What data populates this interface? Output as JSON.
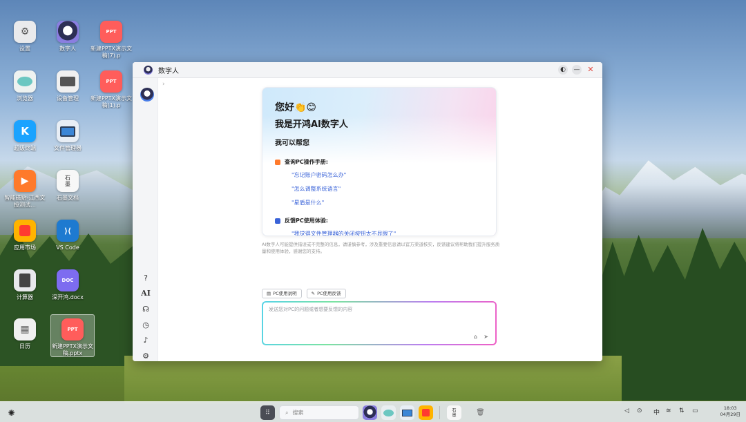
{
  "desktop": {
    "icons": [
      {
        "label": "设置",
        "glyph": "⚙",
        "color": "#e9eaec"
      },
      {
        "label": "数字人",
        "glyph": "●",
        "color": "#e3e0f4"
      },
      {
        "label": "新建PPTX演示文稿(7).p",
        "glyph": "PPT",
        "color": "#ff5d5b"
      },
      {
        "label": "浏览器",
        "glyph": "◉",
        "color": "#eef2f0"
      },
      {
        "label": "设备管理",
        "glyph": "▭",
        "color": "#f0f0f0"
      },
      {
        "label": "新建PPTX演示文稿(1).p",
        "glyph": "PPT",
        "color": "#ff5d5b"
      },
      {
        "label": "超级终端",
        "glyph": "K",
        "color": "#1aa3ff"
      },
      {
        "label": "文件管理器",
        "glyph": "▭",
        "color": "#e8eef5"
      },
      {
        "label": "智能磁贴-江西文投测试…",
        "glyph": "▶",
        "color": "#ff7a2b"
      },
      {
        "label": "石墨文档",
        "glyph": "石墨",
        "color": "#f7f7f7"
      },
      {
        "label": "应用市场",
        "glyph": "▣",
        "color": "#ffb400"
      },
      {
        "label": "VS Code",
        "glyph": "⟨⟩",
        "color": "#1e7ad0"
      },
      {
        "label": "计算器",
        "glyph": "▦",
        "color": "#e8e9ec"
      },
      {
        "label": "深开鸿.docx",
        "glyph": "DOC",
        "color": "#7d6cf0"
      },
      {
        "label": "日历",
        "glyph": "▦",
        "color": "#f0f0f0"
      },
      {
        "label": "新建PPTX演示文稿.pptx",
        "glyph": "PPT",
        "color": "#ff5d5b"
      }
    ]
  },
  "window": {
    "title": "数字人",
    "card": {
      "hello": "您好👏😊",
      "iam": "我是开鸿AI数字人",
      "help": "我可以帮您",
      "section1_title": "查询PC操作手册:",
      "section1_questions": [
        "\"忘记账户密码怎么办\"",
        "\"怎么调整系统语言\"",
        "\"星盾是什么\""
      ],
      "section2_title": "反馈PC使用体验:",
      "section2_questions": [
        "\"我觉得文件管理器的关闭按钮太不显眼了\""
      ]
    },
    "disclaimer": "AI数字人可能提供错误或不完整的信息，请谨慎参考，涉及重要信息请以官方渠道核实，反馈建议将帮助我们提升服务质量和使用体验，感谢您的支持。",
    "actions": [
      "PC使用说明",
      "PC使用反馈"
    ],
    "input_placeholder": "发送您对PC的问题或者想要反馈的内容",
    "sidebar_tools": [
      "?",
      "AI",
      "客服",
      "历史",
      "通知",
      "设置"
    ]
  },
  "taskbar": {
    "search_placeholder": "搜索",
    "clock_time": "18:03",
    "clock_date": "04月29日",
    "ime": "中"
  }
}
